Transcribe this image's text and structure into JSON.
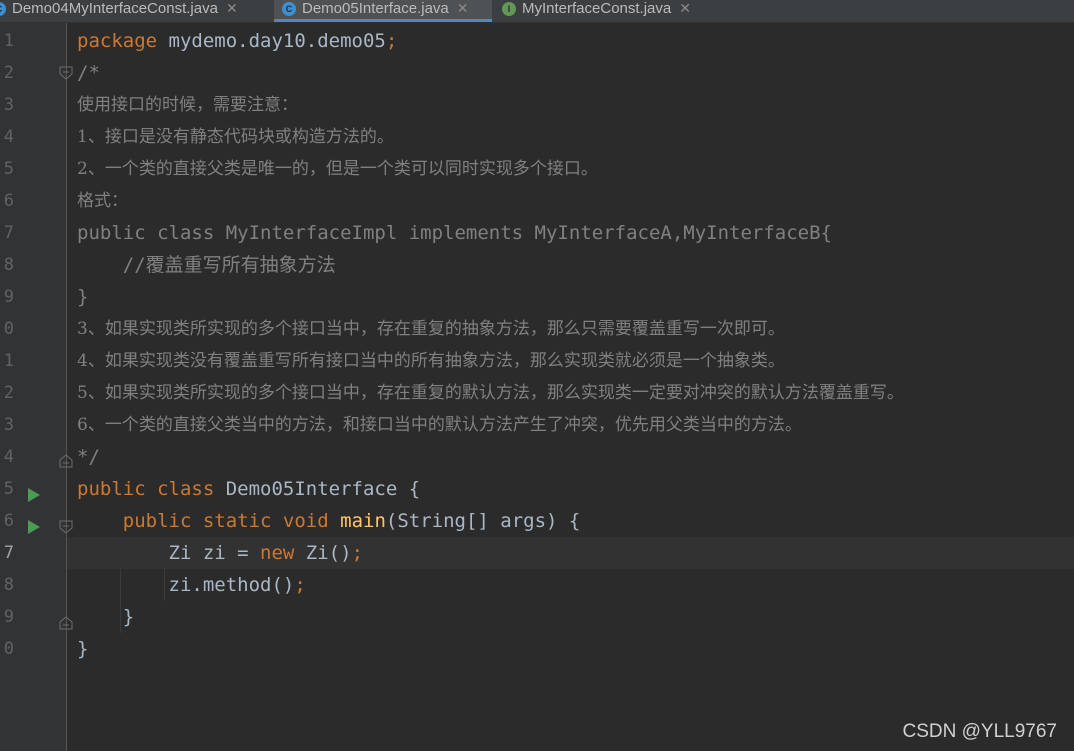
{
  "tabs": [
    {
      "label": "Demo04MyInterfaceConst.java",
      "icon": "class-icon",
      "icon_glyph": "C",
      "active": false,
      "color": "#3d8fd1"
    },
    {
      "label": "Demo05Interface.java",
      "icon": "class-icon",
      "icon_glyph": "C",
      "active": true,
      "color": "#3d8fd1"
    },
    {
      "label": "MyInterfaceConst.java",
      "icon": "interface-icon",
      "icon_glyph": "I",
      "active": false,
      "color": "#629755"
    }
  ],
  "gutter": {
    "line_numbers": [
      "1",
      "2",
      "3",
      "4",
      "5",
      "6",
      "7",
      "8",
      "9",
      "0",
      "1",
      "2",
      "3",
      "4",
      "5",
      "6",
      "7",
      "8",
      "9",
      "0"
    ],
    "current_line_number": "7"
  },
  "code": {
    "l1_kw": "package",
    "l1_rest": " mydemo.day10.demo05",
    "l1_semi": ";",
    "l2": "/*",
    "l3": "使用接口的时候，需要注意：",
    "l4": "1、接口是没有静态代码块或构造方法的。",
    "l5": "2、一个类的直接父类是唯一的，但是一个类可以同时实现多个接口。",
    "l6": "格式：",
    "l7": "public class MyInterfaceImpl implements MyInterfaceA,MyInterfaceB{",
    "l8": "    //覆盖重写所有抽象方法",
    "l9": "}",
    "l10": "3、如果实现类所实现的多个接口当中，存在重复的抽象方法，那么只需要覆盖重写一次即可。",
    "l11": "4、如果实现类没有覆盖重写所有接口当中的所有抽象方法，那么实现类就必须是一个抽象类。",
    "l12": "5、如果实现类所实现的多个接口当中，存在重复的默认方法，那么实现类一定要对冲突的默认方法覆盖重写。",
    "l13": "6、一个类的直接父类当中的方法，和接口当中的默认方法产生了冲突，优先用父类当中的方法。",
    "l14": "*/",
    "l15_kw": "public class",
    "l15_rest": " Demo05Interface {",
    "l16_indent": "    ",
    "l16_kw": "public static void",
    "l16_fn": "main",
    "l16_rest": "(String[] args) {",
    "l17_indent": "        ",
    "l17_a": "Zi zi = ",
    "l17_kw": "new",
    "l17_b": " Zi()",
    "l17_semi": ";",
    "l18_indent": "        ",
    "l18_a": "zi.method()",
    "l18_semi": ";",
    "l19": "    }",
    "l20": "}"
  },
  "watermark": "CSDN @YLL9767",
  "colors": {
    "background": "#2b2b2b",
    "gutter": "#313335",
    "keyword": "#cc7832",
    "function": "#ffc66d",
    "comment": "#808080",
    "text": "#a9b7c6",
    "run_icon": "#499c54",
    "active_tab_underline": "#4a88c7"
  }
}
